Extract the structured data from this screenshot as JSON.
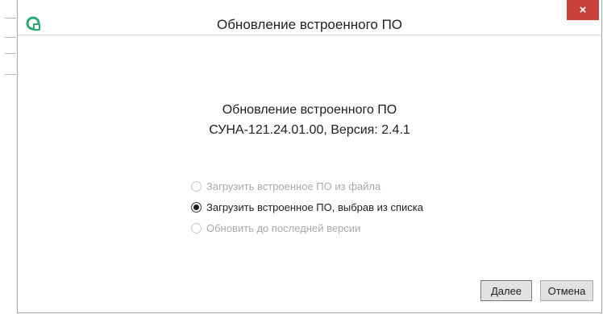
{
  "dialog": {
    "title": "Обновление встроенного ПО",
    "close_glyph": "×",
    "icon": "app-update-icon"
  },
  "content": {
    "heading": "Обновление встроенного ПО",
    "device_version": "СУНА-121.24.01.00, Версия: 2.4.1"
  },
  "options": [
    {
      "label": "Загрузить встроенное ПО из файла",
      "selected": false,
      "enabled": false
    },
    {
      "label": "Загрузить встроенное ПО, выбрав из списка",
      "selected": true,
      "enabled": true
    },
    {
      "label": "Обновить до последней версии",
      "selected": false,
      "enabled": false
    }
  ],
  "buttons": {
    "next_label": "Далее",
    "cancel_label": "Отмена"
  },
  "colors": {
    "close_bg": "#c7413a",
    "icon_green": "#2aa876"
  }
}
